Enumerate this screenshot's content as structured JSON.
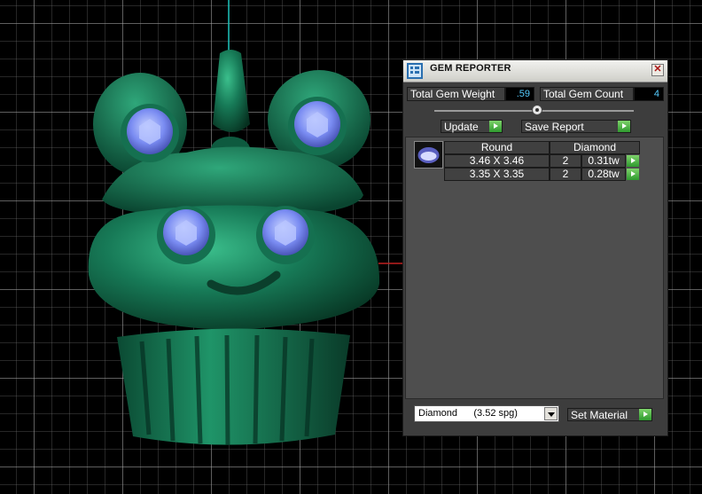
{
  "panel": {
    "title": "GEM REPORTER",
    "close_label": "✕",
    "total_gem_weight_label": "Total Gem Weight",
    "total_gem_weight_value": ".59",
    "total_gem_count_label": "Total Gem Count",
    "total_gem_count_value": "4",
    "update_label": "Update",
    "save_report_label": "Save Report",
    "table": {
      "header_shape": "Round",
      "header_material": "Diamond",
      "rows": [
        {
          "size": "3.46 X 3.46",
          "count": "2",
          "weight": "0.31tw"
        },
        {
          "size": "3.35 X 3.35",
          "count": "2",
          "weight": "0.28tw"
        }
      ]
    },
    "material_select": "Diamond      (3.52 spg)",
    "set_material_label": "Set Material"
  },
  "colors": {
    "accent_green": "#2f9a2f",
    "value_blue": "#55ccff",
    "model_green": "#1a7a58",
    "gem_blue": "#7a8cf2"
  }
}
